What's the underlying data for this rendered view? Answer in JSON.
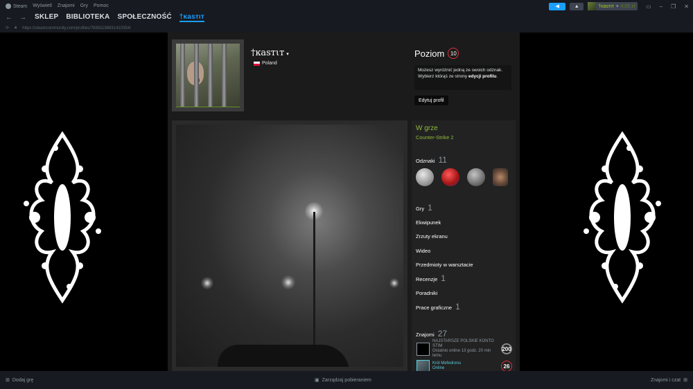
{
  "titlebar": {
    "menu": [
      "Steam",
      "Wyświetl",
      "Znajomi",
      "Gry",
      "Pomoc"
    ],
    "user_name": "†ĸasтιт",
    "wallet": "4,05 zł"
  },
  "nav": {
    "tabs": [
      "SKLEP",
      "BIBLIOTEKA",
      "SPOŁECZNOŚĆ",
      "†ĸasтιт"
    ]
  },
  "url": "https://steamcommunity.com/profiles/76561198831410354/",
  "profile": {
    "name": "†ĸasтιт",
    "caret": "▾",
    "country": "Poland",
    "level_label": "Poziom",
    "level": "10",
    "badge_note_text": "Możesz wyróżnić jedną ze swoich odznak. Wybierz którąś ze strony ",
    "badge_note_link": "edycji profilu",
    "badge_note_end": ".",
    "edit_button": "Edytuj profil"
  },
  "sidebar": {
    "status": "W grze",
    "game": "Counter-Strike 2",
    "badges_label": "Odznaki",
    "badges_count": "11",
    "games_label": "Gry",
    "games_count": "1",
    "inventory": "Ekwipunek",
    "screenshots": "Zrzuty ekranu",
    "videos": "Wideo",
    "workshop": "Przedmioty w warsztacie",
    "reviews_label": "Recenzje",
    "reviews_count": "1",
    "guides": "Poradniki",
    "artwork_label": "Prace graficzne",
    "artwork_count": "1",
    "friends_label": "Znajomi",
    "friends_count": "27",
    "friends": [
      {
        "name": "NAJSTARSZE POLSKIE KONTO STIM",
        "status": "Ostatnio online 13 godz. 20 min temu",
        "level": "200"
      },
      {
        "name": "Król Mefedronu",
        "status": "Online",
        "level": "26"
      }
    ]
  },
  "footer": {
    "add_game": "Dodaj grę",
    "downloads": "Zarządzaj pobieraniem",
    "friends_chat": "Znajomi i czat"
  }
}
